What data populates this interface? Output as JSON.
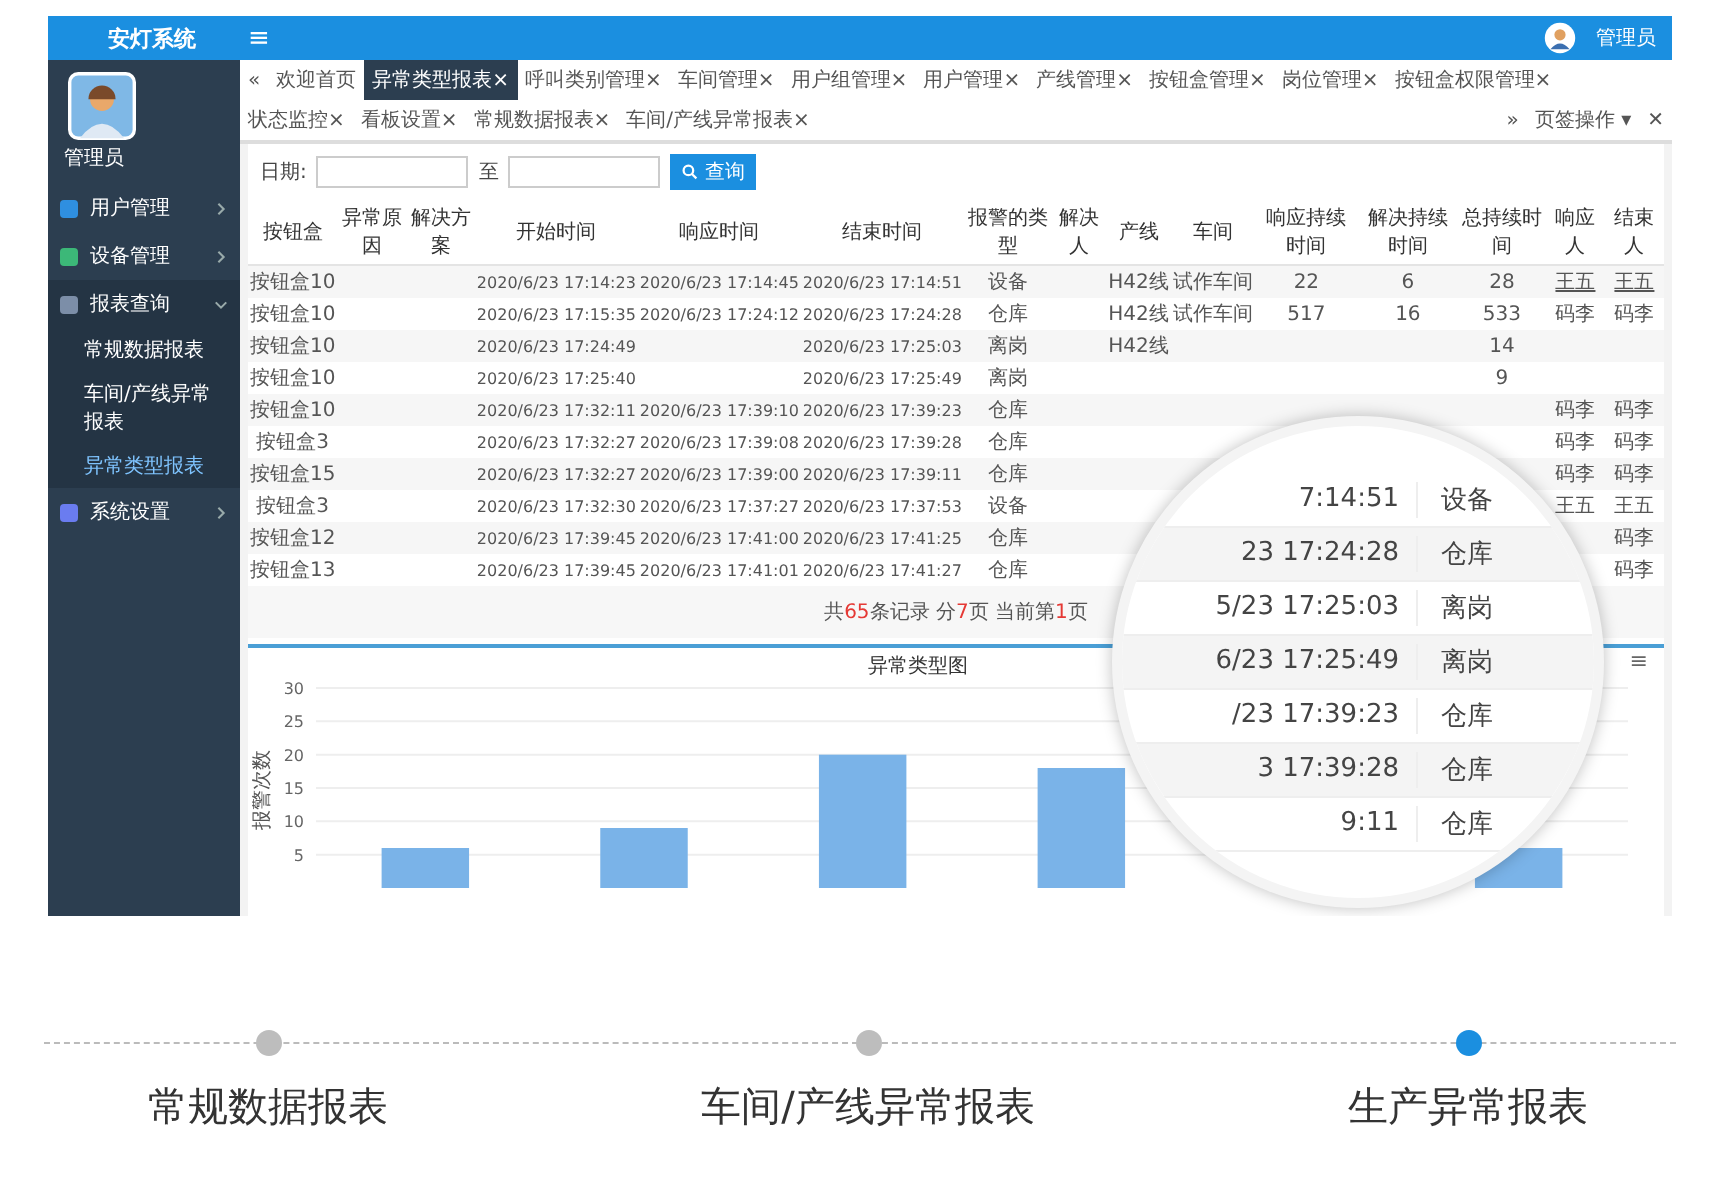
{
  "topbar": {
    "logo": "安灯系统",
    "menu_icon": "≡",
    "user": "管理员"
  },
  "sidebar": {
    "user": "管理员",
    "items": [
      {
        "label": "用户管理",
        "expanded": false
      },
      {
        "label": "设备管理",
        "expanded": false
      },
      {
        "label": "报表查询",
        "expanded": true,
        "children": [
          {
            "label": "常规数据报表",
            "selected": false
          },
          {
            "label": "车间/产线异常报表",
            "selected": false
          },
          {
            "label": "异常类型报表",
            "selected": true
          }
        ]
      },
      {
        "label": "系统设置",
        "expanded": false
      }
    ]
  },
  "tabs": {
    "prev": "«",
    "next": "»",
    "items": [
      {
        "label": "欢迎首页",
        "selected": false,
        "closable": false
      },
      {
        "label": "异常类型报表",
        "selected": true,
        "closable": true
      },
      {
        "label": "呼叫类别管理",
        "selected": false,
        "closable": true
      },
      {
        "label": "车间管理",
        "selected": false,
        "closable": true
      },
      {
        "label": "用户组管理",
        "selected": false,
        "closable": true
      },
      {
        "label": "用户管理",
        "selected": false,
        "closable": true
      },
      {
        "label": "产线管理",
        "selected": false,
        "closable": true
      },
      {
        "label": "按钮盒管理",
        "selected": false,
        "closable": true
      },
      {
        "label": "岗位管理",
        "selected": false,
        "closable": true
      },
      {
        "label": "按钮盒权限管理",
        "selected": false,
        "closable": true
      },
      {
        "label": "状态监控",
        "selected": false,
        "closable": true
      },
      {
        "label": "看板设置",
        "selected": false,
        "closable": true
      },
      {
        "label": "常规数据报表",
        "selected": false,
        "closable": true
      },
      {
        "label": "车间/产线异常报表",
        "selected": false,
        "closable": true
      }
    ],
    "close_mark": "×",
    "actions": "页签操作 ▾",
    "close_all": "✕"
  },
  "search": {
    "date_label": "日期:",
    "to_label": "至",
    "button": "查询"
  },
  "table": {
    "columns": [
      "按钮盒",
      "异常原因",
      "解决方案",
      "开始时间",
      "响应时间",
      "结束时间",
      "报警的类型",
      "解决人",
      "产线",
      "车间",
      "响应持续时间",
      "解决持续时间",
      "总持续时间",
      "响应人",
      "结束人"
    ],
    "rows": [
      [
        "按钮盒10",
        null,
        null,
        "2020/6/23 17:14:23",
        "2020/6/23 17:14:45",
        "2020/6/23 17:14:51",
        "设备",
        null,
        "H42线",
        "试作车间",
        "22",
        "6",
        "28",
        "王五",
        "王五"
      ],
      [
        "按钮盒10",
        null,
        null,
        "2020/6/23 17:15:35",
        "2020/6/23 17:24:12",
        "2020/6/23 17:24:28",
        "仓库",
        null,
        "H42线",
        "试作车间",
        "517",
        "16",
        "533",
        "码李",
        "码李"
      ],
      [
        "按钮盒10",
        null,
        null,
        "2020/6/23 17:24:49",
        null,
        "2020/6/23 17:25:03",
        "离岗",
        null,
        "H42线",
        null,
        null,
        null,
        "14",
        null,
        null
      ],
      [
        "按钮盒10",
        null,
        null,
        "2020/6/23 17:25:40",
        null,
        "2020/6/23 17:25:49",
        "离岗",
        null,
        null,
        null,
        null,
        null,
        "9",
        null,
        null
      ],
      [
        "按钮盒10",
        null,
        null,
        "2020/6/23 17:32:11",
        "2020/6/23 17:39:10",
        "2020/6/23 17:39:23",
        "仓库",
        null,
        null,
        null,
        null,
        null,
        null,
        "码李",
        "码李"
      ],
      [
        "按钮盒3",
        null,
        null,
        "2020/6/23 17:32:27",
        "2020/6/23 17:39:08",
        "2020/6/23 17:39:28",
        "仓库",
        null,
        null,
        null,
        null,
        null,
        null,
        "码李",
        "码李"
      ],
      [
        "按钮盒15",
        null,
        null,
        "2020/6/23 17:32:27",
        "2020/6/23 17:39:00",
        "2020/6/23 17:39:11",
        "仓库",
        null,
        null,
        null,
        null,
        null,
        null,
        "码李",
        "码李"
      ],
      [
        "按钮盒3",
        null,
        null,
        "2020/6/23 17:32:30",
        "2020/6/23 17:37:27",
        "2020/6/23 17:37:53",
        "设备",
        null,
        null,
        null,
        null,
        null,
        null,
        "王五",
        "王五"
      ],
      [
        "按钮盒12",
        null,
        null,
        "2020/6/23 17:39:45",
        "2020/6/23 17:41:00",
        "2020/6/23 17:41:25",
        "仓库",
        null,
        null,
        null,
        null,
        null,
        null,
        null,
        "码李"
      ],
      [
        "按钮盒13",
        null,
        null,
        "2020/6/23 17:39:45",
        "2020/6/23 17:41:01",
        "2020/6/23 17:41:27",
        "仓库",
        null,
        null,
        null,
        null,
        null,
        null,
        null,
        "码李"
      ]
    ]
  },
  "pagination": [
    {
      "text": "共",
      "kind": "plain"
    },
    {
      "text": "65",
      "kind": "num"
    },
    {
      "text": "条记录 分",
      "kind": "plain"
    },
    {
      "text": "7",
      "kind": "num"
    },
    {
      "text": "页 当前第",
      "kind": "plain"
    },
    {
      "text": "1",
      "kind": "num"
    },
    {
      "text": "页",
      "kind": "plain"
    }
  ],
  "chart": {
    "menu_icon": "≡",
    "chart_data": {
      "type": "bar",
      "title": "异常类型图",
      "ylabel": "报警次数",
      "values": [
        6,
        9,
        20,
        18,
        null,
        6
      ],
      "ylim": [
        0,
        30
      ],
      "yticks": [
        5,
        10,
        15,
        20,
        25,
        30
      ],
      "grid": true
    }
  },
  "magnifier": {
    "rows": [
      {
        "time": "7:14:51",
        "type": "设备"
      },
      {
        "time": "23 17:24:28",
        "type": "仓库"
      },
      {
        "time": "5/23 17:25:03",
        "type": "离岗"
      },
      {
        "time": "6/23 17:25:49",
        "type": "离岗"
      },
      {
        "time": "/23 17:39:23",
        "type": "仓库"
      },
      {
        "time": "3 17:39:28",
        "type": "仓库"
      },
      {
        "time": "9:11",
        "type": "仓库"
      }
    ]
  },
  "carousel": [
    {
      "label": "常规数据报表",
      "selected": false
    },
    {
      "label": "车间/产线异常报表",
      "selected": false
    },
    {
      "label": "生产异常报表",
      "selected": true
    }
  ]
}
